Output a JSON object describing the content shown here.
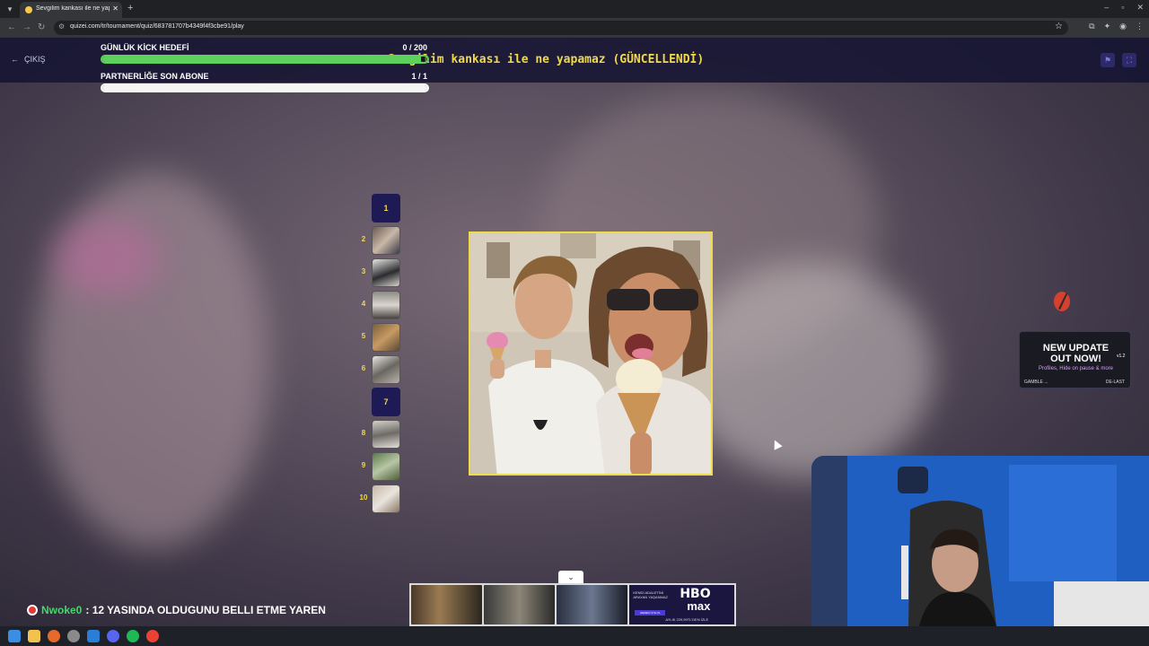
{
  "browser": {
    "tab_title": "Sevgilim kankası ile ne yapama",
    "url": "quizei.com/tr/tournament/quiz/683781707b4349f4f3cbe91/play"
  },
  "page": {
    "exit_label": "ÇIKIŞ",
    "title": "Sevgilim kankası ile ne yapamaz (GÜNCELLENDİ)"
  },
  "goals": [
    {
      "label": "GÜNLÜK KİCK HEDEFİ",
      "count": "0  / 200",
      "progress": 0.98
    },
    {
      "label": "PARTNERLİĞE SON ABONE",
      "count": "1  / 1",
      "progress": 1.0
    }
  ],
  "rounds": [
    {
      "number": "1",
      "current": true
    },
    {
      "number": "2",
      "current": false
    },
    {
      "number": "3",
      "current": false
    },
    {
      "number": "4",
      "current": false
    },
    {
      "number": "5",
      "current": false
    },
    {
      "number": "6",
      "current": false
    },
    {
      "number": "7",
      "current": true
    },
    {
      "number": "8",
      "current": false
    },
    {
      "number": "9",
      "current": false
    },
    {
      "number": "10",
      "current": false
    }
  ],
  "update_badge": {
    "title_line1": "NEW UPDATE",
    "title_line2": "OUT NOW!",
    "version": "v1.2",
    "subtitle": "Profiles, Hide on pause & more",
    "footer_left": "GAMBLE ...",
    "footer_right": "DE-LAST"
  },
  "chat": {
    "username": "Nwoke0",
    "message": ": 12 YASINDA OLDUGUNU BELLI ETME YAREN"
  },
  "ad": {
    "hbo_logo": "HBO",
    "hbo_max": "max",
    "hbo_text": "KENDİ ADALETİNİ ARAYAN YAŞANMAZ",
    "hbo_button": "HEMEN ÜYE OL",
    "hbo_price": "AYLIK 229,99TL'DEN İZLE"
  },
  "colors": {
    "accent_yellow": "#f0d94a",
    "header_bg": "#161432",
    "chat_user": "#43d96b",
    "goal_green": "#5dd05d"
  }
}
